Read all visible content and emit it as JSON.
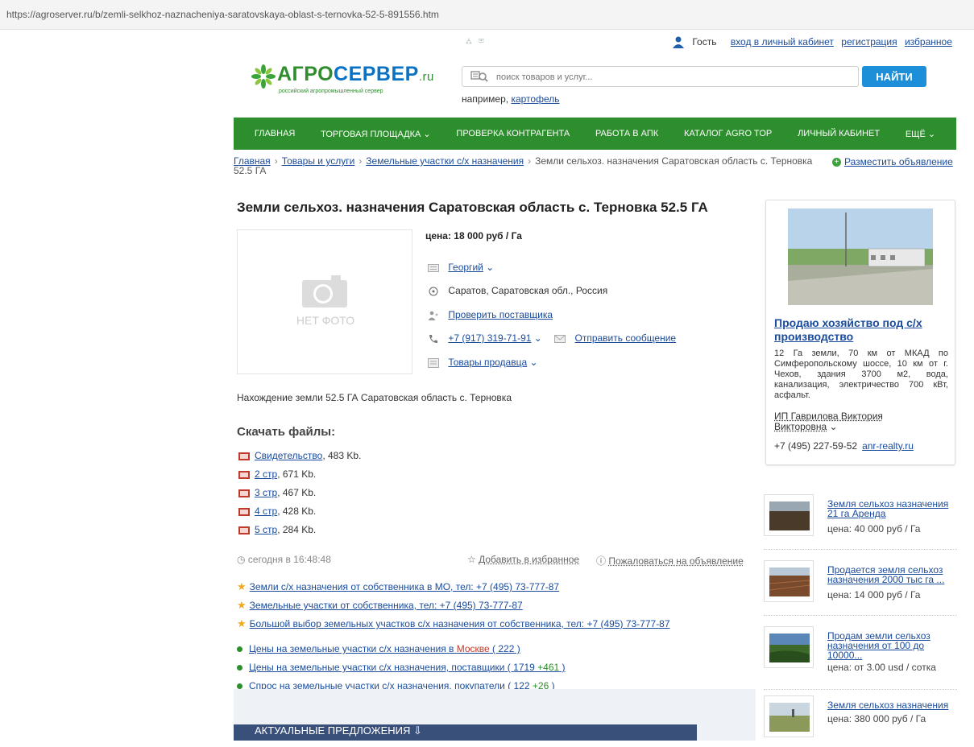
{
  "browser": {
    "url": "https://agroserver.ru/b/zemli-selkhoz-naznacheniya-saratovskaya-oblast-s-ternovka-52-5-891556.htm"
  },
  "userbar": {
    "guest": "Гость",
    "login": "вход в личный кабинет",
    "register": "регистрация",
    "favorites": "избранное"
  },
  "logo": {
    "name_green": "АГРО",
    "name_blue": "СЕРВЕР",
    "name_ru": ".ru",
    "tagline": "российский агропромышленный сервер"
  },
  "search": {
    "placeholder": "поиск товаров и услуг...",
    "button": "НАЙТИ",
    "example_prefix": "например,",
    "example_link": "картофель"
  },
  "nav": {
    "items": [
      "ГЛАВНАЯ",
      "ТОРГОВАЯ ПЛОЩАДКА ⌄",
      "ПРОВЕРКА КОНТРАГЕНТА",
      "РАБОТА В АПК",
      "КАТАЛОГ AGRO TOP",
      "ЛИЧНЫЙ КАБИНЕТ",
      "ЕЩЁ ⌄"
    ]
  },
  "breadcrumbs": {
    "items": [
      "Главная",
      "Товары и услуги",
      "Земельные участки с/х назначения"
    ],
    "current": "Земли сельхоз. назначения Саратовская область с. Терновка 52.5 ГА",
    "post_ad": "Разместить объявление"
  },
  "listing": {
    "title": "Земли сельхоз. назначения Саратовская область с. Терновка 52.5 ГА",
    "no_photo": "НЕТ ФОТО",
    "price": "цена: 18 000 руб / Га",
    "seller": "Георгий",
    "location": "Саратов, Саратовская обл., Россия",
    "check_supplier": "Проверить поставщика",
    "phone": "+7 (917) 319-71-91",
    "send_message": "Отправить сообщение",
    "seller_goods": "Товары продавца",
    "description": "Нахождение земли 52.5 ГА Саратовская область с. Терновка"
  },
  "files": {
    "heading": "Скачать файлы:",
    "items": [
      {
        "name": "Свидетельство",
        "size": ", 483 Kb."
      },
      {
        "name": "2 стр",
        "size": ", 671 Kb."
      },
      {
        "name": "3 стр",
        "size": ", 467 Kb."
      },
      {
        "name": "4 стр",
        "size": ", 428 Kb."
      },
      {
        "name": "5 стр",
        "size": ", 284 Kb."
      }
    ]
  },
  "meta": {
    "date": "сегодня в 16:48:48",
    "add_favorite": "Добавить в избранное",
    "complain": "Пожаловаться на объявление"
  },
  "ads": [
    "Земли с/х назначения от собственника в МО, тел: +7 (495) 73-777-87",
    "Земельные участки от собственника, тел: +7 (495) 73-777-87",
    "Большой выбор земельных участков с/х назначения от собственника, тел: +7 (495) 73-777-87"
  ],
  "related": {
    "r1_text": "Цены на земельные участки с/х назначения в ",
    "r1_city": "Москве",
    "r1_open": " ( ",
    "r1_count": "222",
    "r1_close": " )",
    "r2_text": "Цены на земельные участки с/х назначения, поставщики",
    "r2_open": " ( ",
    "r2_count": "1719",
    "r2_plus": " +461",
    "r2_close": " )",
    "r3_text": "Спрос на земельные участки с/х назначения, покупатели",
    "r3_open": " ( ",
    "r3_count": "122",
    "r3_plus": " +26",
    "r3_close": " )"
  },
  "bottom": {
    "tab": "АКТУАЛЬНЫЕ ПРЕДЛОЖЕНИЯ"
  },
  "featured": {
    "title": "Продаю хозяйство под с/х производство",
    "description": "12 Га земли, 70 км от МКАД по Симферопольскому шоссе, 10 км от г. Чехов, здания 3700 м2, вода, канализация, электричество 700 кВт, асфальт.",
    "seller": "ИП Гаврилова Виктория Викторовна",
    "phone": "+7 (495) 227-59-52",
    "site": "anr-realty.ru"
  },
  "sidebar_list": [
    {
      "title": "Земля сельхоз назначения 21 га Аренда",
      "price": "цена: 40 000 руб / Га"
    },
    {
      "title": "Продается земля сельхоз назначения 2000 тыс га ...",
      "price": "цена: 14 000 руб / Га"
    },
    {
      "title": "Продам земли сельхоз назначения от 100 до 10000...",
      "price": "цена: от 3.00 usd / сотка"
    },
    {
      "title": "Земля сельхоз назначения",
      "price": "цена: 380 000 руб / Га"
    }
  ],
  "colors": {
    "brand_green": "#2d8e2d",
    "brand_blue": "#1d8fd8",
    "link": "#1a4b9c",
    "star": "#f2a91b"
  }
}
